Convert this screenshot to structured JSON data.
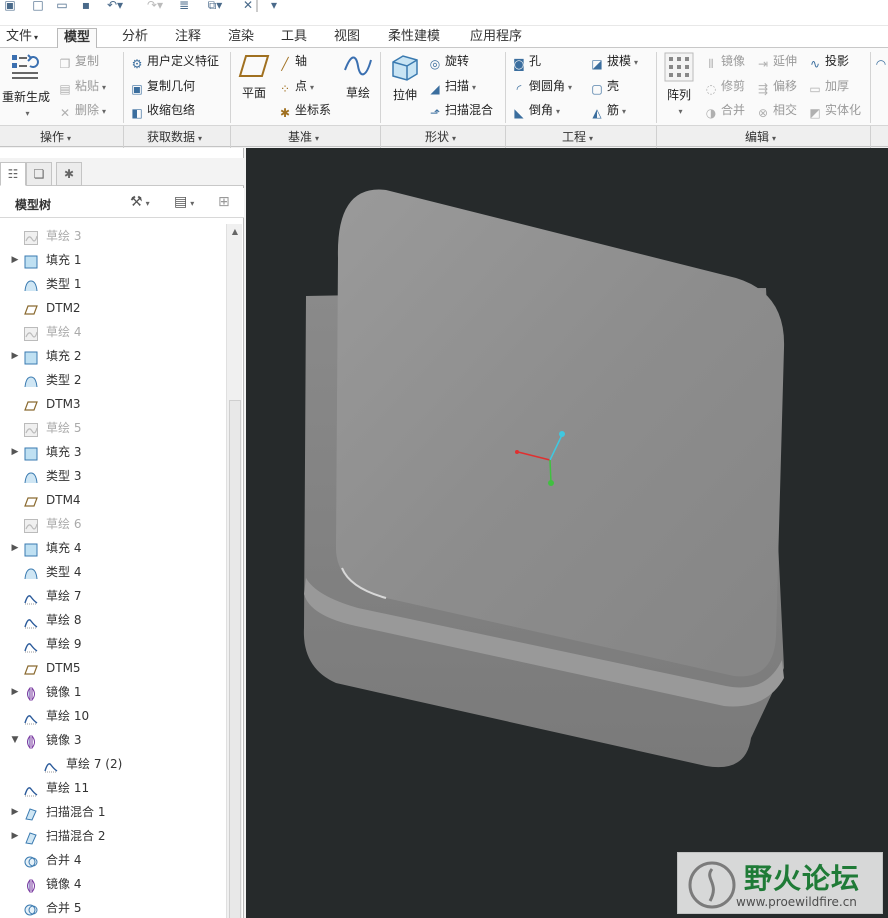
{
  "ribbon_tabs": [
    {
      "label": "文件",
      "has_menu": true
    },
    {
      "label": "模型",
      "active": true
    },
    {
      "label": "分析"
    },
    {
      "label": "注释"
    },
    {
      "label": "渲染"
    },
    {
      "label": "工具"
    },
    {
      "label": "视图"
    },
    {
      "label": "柔性建模"
    },
    {
      "label": "应用程序"
    }
  ],
  "ribbon": {
    "operations": {
      "regenerate": "重新生成",
      "copy": "复制",
      "paste": "粘贴",
      "delete": "删除"
    },
    "get_data": {
      "user_defined_feature": "用户定义特征",
      "copy_geometry": "复制几何",
      "shrinkwrap": "收缩包络"
    },
    "datum": {
      "plane": "平面",
      "axis": "轴",
      "point": "点",
      "coordinate_system": "坐标系",
      "sketch": "草绘"
    },
    "shapes": {
      "extrude": "拉伸",
      "revolve": "旋转",
      "sweep": "扫描",
      "swept_blend": "扫描混合"
    },
    "engineering": {
      "hole": "孔",
      "draft": "拔模",
      "round": "倒圆角",
      "shell": "壳",
      "chamfer": "倒角",
      "rib": "筋"
    },
    "editing": {
      "pattern": "阵列",
      "mirror": "镜像",
      "extend": "延伸",
      "project": "投影",
      "trim": "修剪",
      "offset": "偏移",
      "thicken": "加厚",
      "merge": "合并",
      "intersect": "相交",
      "solidify": "实体化"
    }
  },
  "group_labels": [
    "操作",
    "获取数据",
    "基准",
    "形状",
    "工程",
    "编辑"
  ],
  "model_tree": {
    "title": "模型树",
    "items": [
      {
        "label": "草绘 3",
        "type": "sketch-hidden",
        "dim": true
      },
      {
        "label": "填充 1",
        "type": "fill",
        "expand": "▶"
      },
      {
        "label": "类型 1",
        "type": "style"
      },
      {
        "label": "DTM2",
        "type": "datum-plane"
      },
      {
        "label": "草绘 4",
        "type": "sketch-hidden",
        "dim": true
      },
      {
        "label": "填充 2",
        "type": "fill",
        "expand": "▶"
      },
      {
        "label": "类型 2",
        "type": "style"
      },
      {
        "label": "DTM3",
        "type": "datum-plane"
      },
      {
        "label": "草绘 5",
        "type": "sketch-hidden",
        "dim": true
      },
      {
        "label": "填充 3",
        "type": "fill",
        "expand": "▶"
      },
      {
        "label": "类型 3",
        "type": "style"
      },
      {
        "label": "DTM4",
        "type": "datum-plane"
      },
      {
        "label": "草绘 6",
        "type": "sketch-hidden",
        "dim": true
      },
      {
        "label": "填充 4",
        "type": "fill",
        "expand": "▶"
      },
      {
        "label": "类型 4",
        "type": "style"
      },
      {
        "label": "草绘 7",
        "type": "sketch"
      },
      {
        "label": "草绘 8",
        "type": "sketch"
      },
      {
        "label": "草绘 9",
        "type": "sketch"
      },
      {
        "label": "DTM5",
        "type": "datum-plane"
      },
      {
        "label": "镜像 1",
        "type": "mirror",
        "expand": "▶"
      },
      {
        "label": "草绘 10",
        "type": "sketch"
      },
      {
        "label": "镜像 3",
        "type": "mirror",
        "expand": "▼"
      },
      {
        "label": "草绘 7 (2)",
        "type": "sketch",
        "indent": true
      },
      {
        "label": "草绘 11",
        "type": "sketch"
      },
      {
        "label": "扫描混合 1",
        "type": "swept-blend",
        "expand": "▶"
      },
      {
        "label": "扫描混合 2",
        "type": "swept-blend",
        "expand": "▶"
      },
      {
        "label": "合并 4",
        "type": "merge"
      },
      {
        "label": "镜像 4",
        "type": "mirror"
      },
      {
        "label": "合并 5",
        "type": "merge"
      }
    ]
  },
  "watermark": {
    "title": "野火论坛",
    "url": "www.proewildfire.cn"
  },
  "colors": {
    "viewport_bg": "#262a2b",
    "model_gray": "#8c8c8c",
    "axis_x": "#e03030",
    "axis_y": "#40c040",
    "axis_z": "#40c8e0",
    "watermark_green": "#1e8a3a"
  }
}
